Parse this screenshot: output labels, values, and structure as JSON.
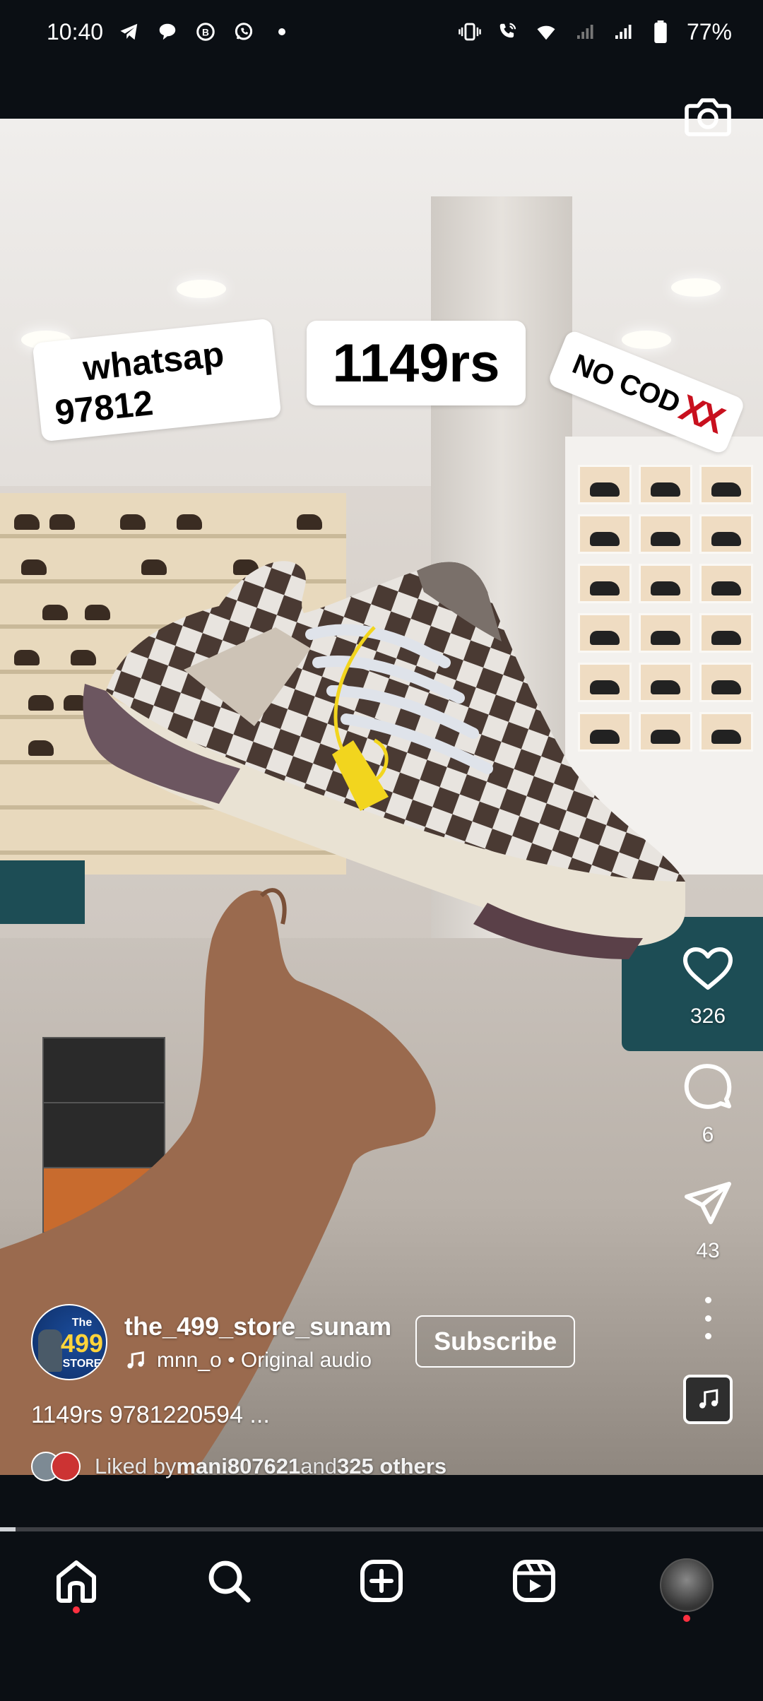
{
  "status_bar": {
    "time": "10:40",
    "left_icons": [
      "telegram-icon",
      "chat-bubble-icon",
      "business-icon",
      "whatsapp-icon",
      "dot-icon"
    ],
    "right_icons": [
      "vibrate-icon",
      "wifi-calling-icon",
      "wifi-icon",
      "signal-icon",
      "signal-icon",
      "battery-icon"
    ],
    "battery": "77%"
  },
  "reel": {
    "stickers": {
      "whatsapp_line1": "whatsap",
      "whatsapp_line2": "97812",
      "price": "1149rs",
      "no_cod": "NO COD",
      "no_cod_marks": "XX"
    },
    "camera_icon": "camera-icon"
  },
  "actions": {
    "likes": "326",
    "comments": "6",
    "shares": "43"
  },
  "author": {
    "username": "the_499_store_sunam",
    "avatar_text_the": "The",
    "avatar_text_num": "499",
    "avatar_text_store": "STORE",
    "audio": "mnn_o • Original audio",
    "subscribe_label": "Subscribe"
  },
  "caption": "1149rs 9781220594 ...",
  "liked_by": {
    "prefix": "Liked by ",
    "user": "mani807621",
    "middle": " and ",
    "others": "325 others"
  },
  "progress": 0.02,
  "bottom_nav": {
    "items": [
      "home-icon",
      "search-icon",
      "create-icon",
      "reels-icon",
      "profile-avatar"
    ]
  },
  "colors": {
    "background": "#0b0f14",
    "notification_dot": "#ff3040",
    "nocod_x": "#c8101e"
  }
}
